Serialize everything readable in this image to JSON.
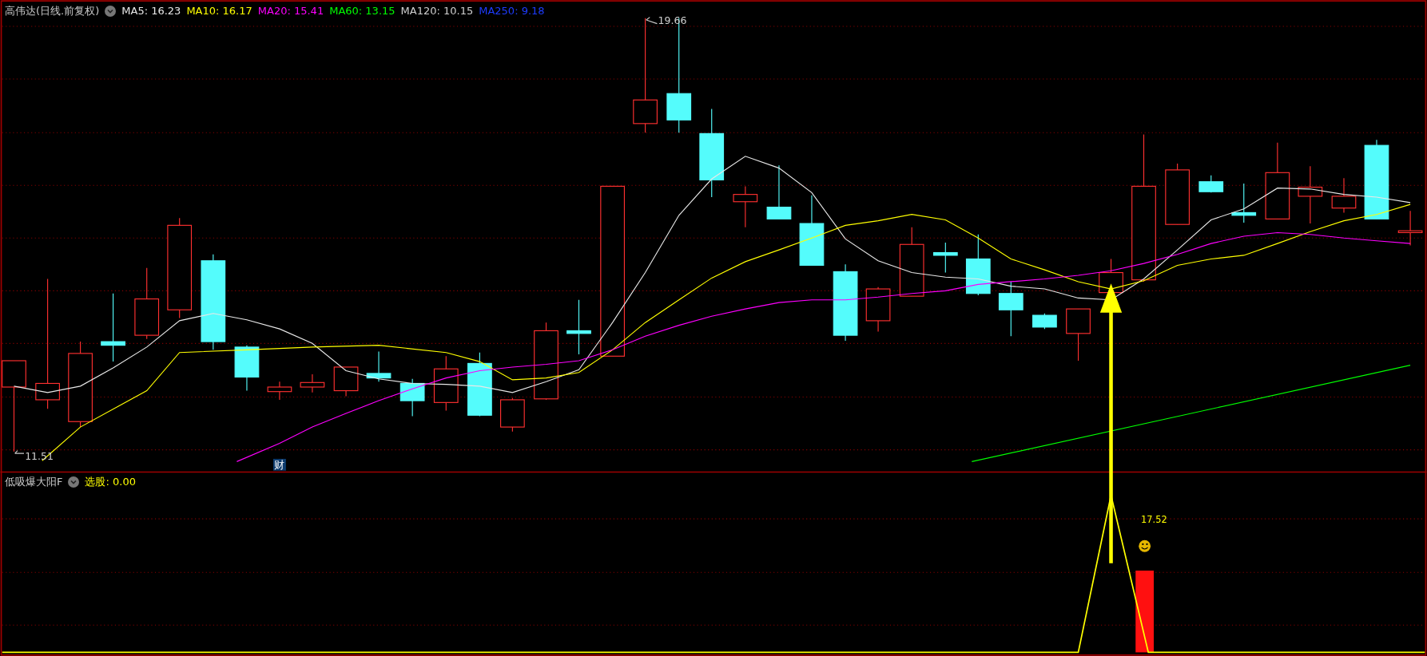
{
  "main_panel": {
    "title": "高伟达(日线.前复权)",
    "indicators": [
      {
        "label": "MA5: 16.23",
        "color": "#e8e8e8"
      },
      {
        "label": "MA10: 16.17",
        "color": "#ffff00"
      },
      {
        "label": "MA20: 15.41",
        "color": "#ff00ff"
      },
      {
        "label": "MA60: 13.15",
        "color": "#00ff00"
      },
      {
        "label": "MA120: 10.15",
        "color": "#d0d0d0"
      },
      {
        "label": "MA250: 9.18",
        "color": "#1e3cff"
      }
    ],
    "high_label": "19.66",
    "low_label": "11.51",
    "event_marker": "财"
  },
  "sub_panel": {
    "title": "低吸爆大阳F",
    "indicators": [
      {
        "label": "选股: 0.00",
        "color": "#ffff00"
      }
    ],
    "signal_label": "17.52"
  }
}
